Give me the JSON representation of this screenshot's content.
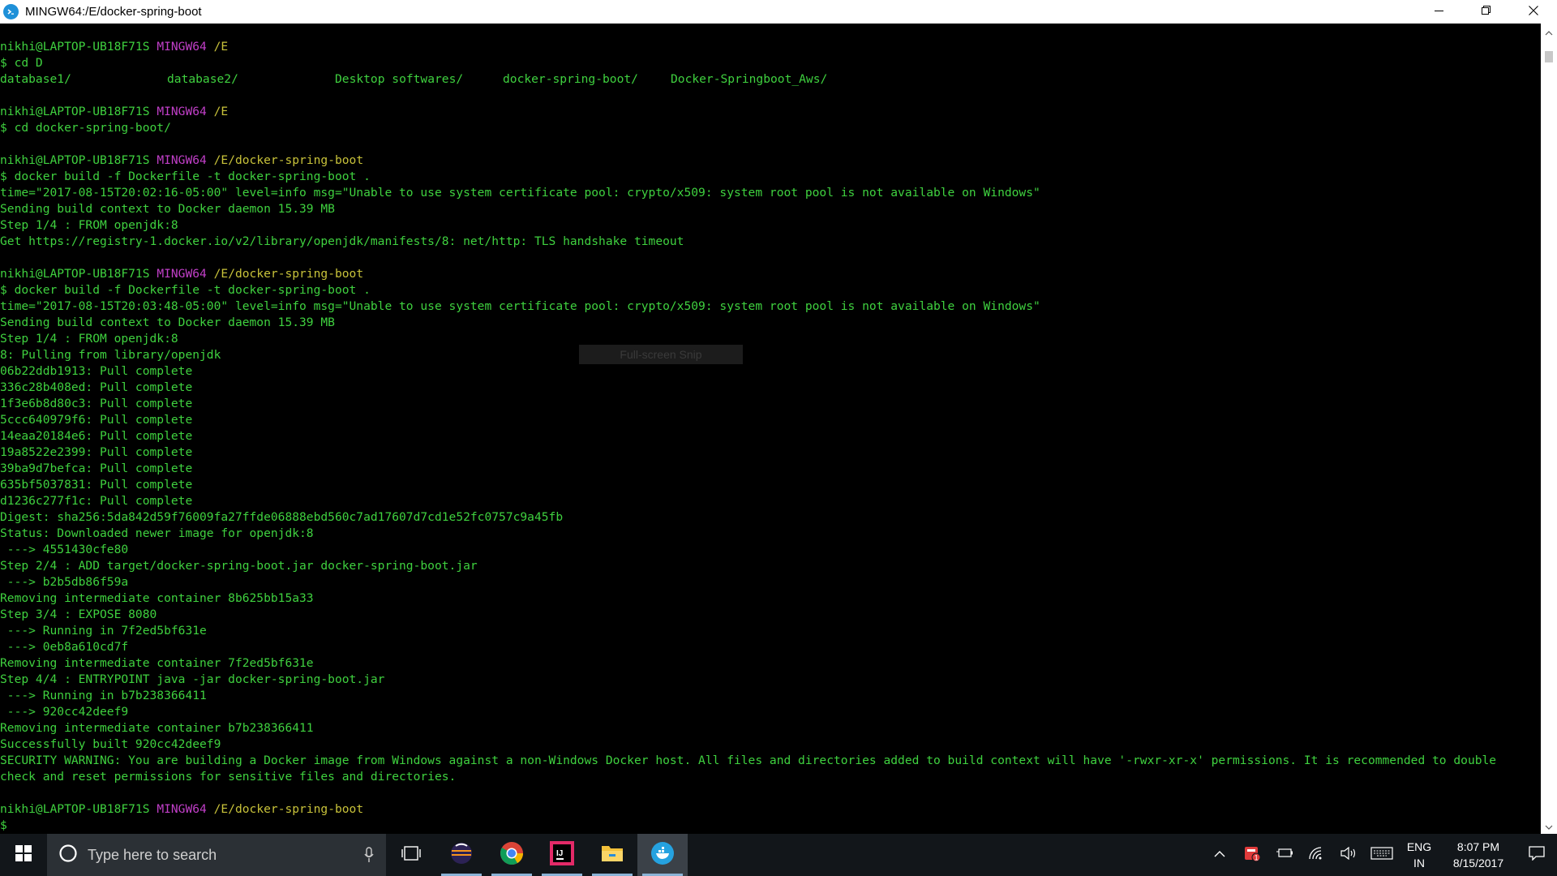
{
  "window": {
    "title": "MINGW64:/E/docker-spring-boot",
    "icon": "git-bash-icon",
    "buttons": [
      "minimize-icon",
      "restore-icon",
      "close-icon"
    ]
  },
  "terminal": {
    "colors": {
      "text": "#3fd13f",
      "host": "#c13fc8",
      "path": "#c8c23a",
      "background": "#000000"
    },
    "prompt": {
      "user": "nikhi@LAPTOP-UB18F71S",
      "host": "MINGW64"
    },
    "lines": [
      {
        "kind": "prompt",
        "path": "/E"
      },
      {
        "kind": "text",
        "text": "$ cd D"
      },
      {
        "kind": "dirs",
        "items": [
          "database1/",
          "database2/",
          "Desktop softwares/",
          "docker-spring-boot/",
          "Docker-Springboot_Aws/"
        ]
      },
      {
        "kind": "blank"
      },
      {
        "kind": "prompt",
        "path": "/E"
      },
      {
        "kind": "text",
        "text": "$ cd docker-spring-boot/"
      },
      {
        "kind": "blank"
      },
      {
        "kind": "prompt",
        "path": "/E/docker-spring-boot"
      },
      {
        "kind": "text",
        "text": "$ docker build -f Dockerfile -t docker-spring-boot ."
      },
      {
        "kind": "text",
        "text": "time=\"2017-08-15T20:02:16-05:00\" level=info msg=\"Unable to use system certificate pool: crypto/x509: system root pool is not available on Windows\""
      },
      {
        "kind": "text",
        "text": "Sending build context to Docker daemon 15.39 MB"
      },
      {
        "kind": "text",
        "text": "Step 1/4 : FROM openjdk:8"
      },
      {
        "kind": "text",
        "text": "Get https://registry-1.docker.io/v2/library/openjdk/manifests/8: net/http: TLS handshake timeout"
      },
      {
        "kind": "blank"
      },
      {
        "kind": "prompt",
        "path": "/E/docker-spring-boot"
      },
      {
        "kind": "text",
        "text": "$ docker build -f Dockerfile -t docker-spring-boot ."
      },
      {
        "kind": "text",
        "text": "time=\"2017-08-15T20:03:48-05:00\" level=info msg=\"Unable to use system certificate pool: crypto/x509: system root pool is not available on Windows\""
      },
      {
        "kind": "text",
        "text": "Sending build context to Docker daemon 15.39 MB"
      },
      {
        "kind": "text",
        "text": "Step 1/4 : FROM openjdk:8"
      },
      {
        "kind": "text",
        "text": "8: Pulling from library/openjdk"
      },
      {
        "kind": "text",
        "text": "06b22ddb1913: Pull complete"
      },
      {
        "kind": "text",
        "text": "336c28b408ed: Pull complete"
      },
      {
        "kind": "text",
        "text": "1f3e6b8d80c3: Pull complete"
      },
      {
        "kind": "text",
        "text": "5ccc640979f6: Pull complete"
      },
      {
        "kind": "text",
        "text": "14eaa20184e6: Pull complete"
      },
      {
        "kind": "text",
        "text": "19a8522e2399: Pull complete"
      },
      {
        "kind": "text",
        "text": "39ba9d7befca: Pull complete"
      },
      {
        "kind": "text",
        "text": "635bf5037831: Pull complete"
      },
      {
        "kind": "text",
        "text": "d1236c277f1c: Pull complete"
      },
      {
        "kind": "text",
        "text": "Digest: sha256:5da842d59f76009fa27ffde06888ebd560c7ad17607d7cd1e52fc0757c9a45fb"
      },
      {
        "kind": "text",
        "text": "Status: Downloaded newer image for openjdk:8"
      },
      {
        "kind": "text",
        "text": " ---> 4551430cfe80"
      },
      {
        "kind": "text",
        "text": "Step 2/4 : ADD target/docker-spring-boot.jar docker-spring-boot.jar"
      },
      {
        "kind": "text",
        "text": " ---> b2b5db86f59a"
      },
      {
        "kind": "text",
        "text": "Removing intermediate container 8b625bb15a33"
      },
      {
        "kind": "text",
        "text": "Step 3/4 : EXPOSE 8080"
      },
      {
        "kind": "text",
        "text": " ---> Running in 7f2ed5bf631e"
      },
      {
        "kind": "text",
        "text": " ---> 0eb8a610cd7f"
      },
      {
        "kind": "text",
        "text": "Removing intermediate container 7f2ed5bf631e"
      },
      {
        "kind": "text",
        "text": "Step 4/4 : ENTRYPOINT java -jar docker-spring-boot.jar"
      },
      {
        "kind": "text",
        "text": " ---> Running in b7b238366411"
      },
      {
        "kind": "text",
        "text": " ---> 920cc42deef9"
      },
      {
        "kind": "text",
        "text": "Removing intermediate container b7b238366411"
      },
      {
        "kind": "text",
        "text": "Successfully built 920cc42deef9"
      },
      {
        "kind": "text",
        "text": "SECURITY WARNING: You are building a Docker image from Windows against a non-Windows Docker host. All files and directories added to build context will have '-rwxr-xr-x' permissions. It is recommended to double"
      },
      {
        "kind": "text",
        "text": "check and reset permissions for sensitive files and directories."
      },
      {
        "kind": "blank"
      },
      {
        "kind": "prompt",
        "path": "/E/docker-spring-boot"
      },
      {
        "kind": "text",
        "text": "$"
      }
    ],
    "overlay_text": "Full-screen Snip"
  },
  "taskbar": {
    "search_placeholder": "Type here to search",
    "apps": [
      {
        "name": "task-view-icon",
        "state": ""
      },
      {
        "name": "eclipse-icon",
        "state": "open"
      },
      {
        "name": "chrome-icon",
        "state": "open"
      },
      {
        "name": "intellij-icon",
        "state": "open"
      },
      {
        "name": "file-explorer-icon",
        "state": "open"
      },
      {
        "name": "docker-icon",
        "state": "active"
      }
    ],
    "tray": {
      "language_line1": "ENG",
      "language_line2": "IN",
      "time": "8:07 PM",
      "date": "8/15/2017",
      "badge_count": "1"
    }
  }
}
